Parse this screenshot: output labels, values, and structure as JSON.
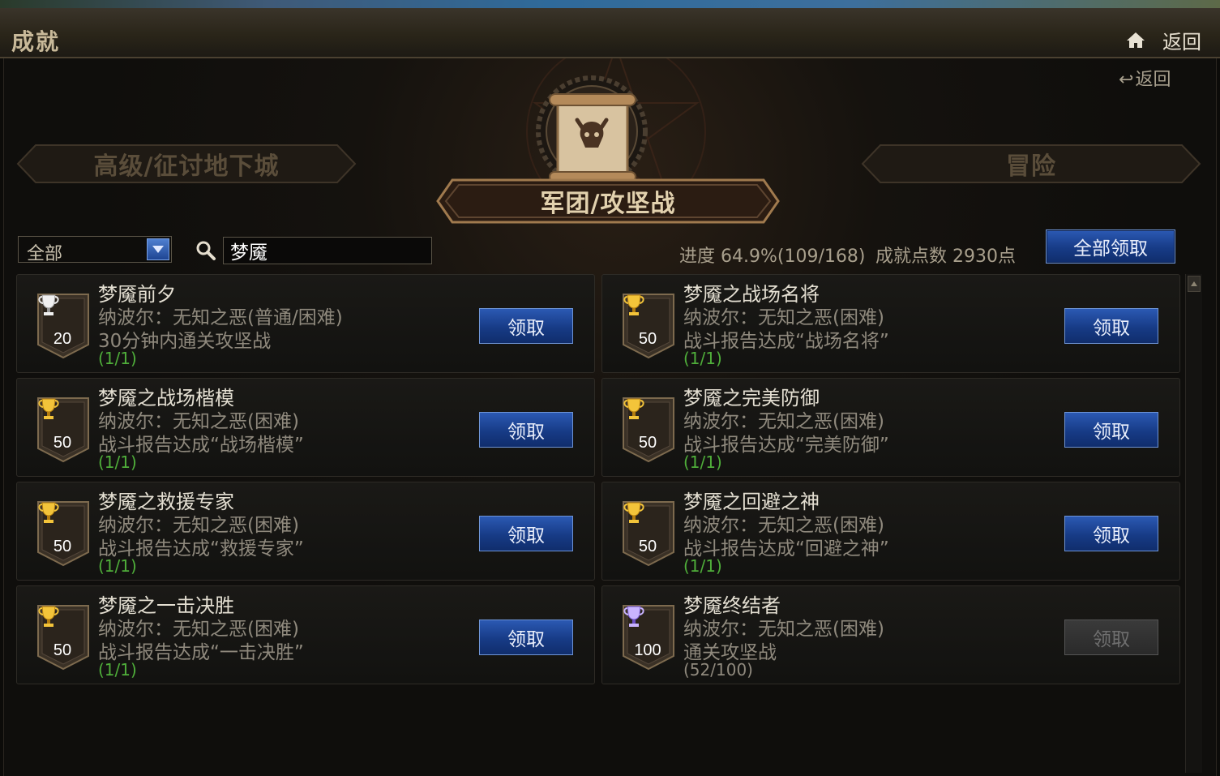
{
  "header": {
    "title": "成就",
    "back_label": "返回"
  },
  "sub_back_label": "返回",
  "tabs": {
    "left": "高级/征讨地下城",
    "center": "军团/攻坚战",
    "right": "冒险"
  },
  "filter": {
    "select_value": "全部",
    "search_value": "梦魇"
  },
  "summary": {
    "progress_label": "进度",
    "progress_value": "64.9%(109/168)",
    "points_label": "成就点数",
    "points_value": "2930点",
    "claim_all_label": "全部领取"
  },
  "colors": {
    "button_blue": "#173b86",
    "progress_green": "#4fae3a",
    "gold_trophy": "#d9a21b",
    "silver_trophy": "#d0d0d0",
    "purple_trophy": "#9b7fe0"
  },
  "achievements": [
    {
      "name": "梦魇前夕",
      "dungeon": "纳波尔：无知之恶(普通/困难)",
      "desc": "30分钟内通关攻坚战",
      "progress": "(1/1)",
      "points": "20",
      "trophy": "silver-trophy-icon",
      "claim_label": "领取",
      "claimable": true
    },
    {
      "name": "梦魇之战场名将",
      "dungeon": "纳波尔：无知之恶(困难)",
      "desc": "战斗报告达成“战场名将”",
      "progress": "(1/1)",
      "points": "50",
      "trophy": "gold-trophy-icon",
      "claim_label": "领取",
      "claimable": true
    },
    {
      "name": "梦魇之战场楷模",
      "dungeon": "纳波尔：无知之恶(困难)",
      "desc": "战斗报告达成“战场楷模”",
      "progress": "(1/1)",
      "points": "50",
      "trophy": "gold-trophy-icon",
      "claim_label": "领取",
      "claimable": true
    },
    {
      "name": "梦魇之完美防御",
      "dungeon": "纳波尔：无知之恶(困难)",
      "desc": "战斗报告达成“完美防御”",
      "progress": "(1/1)",
      "points": "50",
      "trophy": "gold-trophy-icon",
      "claim_label": "领取",
      "claimable": true
    },
    {
      "name": "梦魇之救援专家",
      "dungeon": "纳波尔：无知之恶(困难)",
      "desc": "战斗报告达成“救援专家”",
      "progress": "(1/1)",
      "points": "50",
      "trophy": "gold-trophy-icon",
      "claim_label": "领取",
      "claimable": true
    },
    {
      "name": "梦魇之回避之神",
      "dungeon": "纳波尔：无知之恶(困难)",
      "desc": "战斗报告达成“回避之神”",
      "progress": "(1/1)",
      "points": "50",
      "trophy": "gold-trophy-icon",
      "claim_label": "领取",
      "claimable": true
    },
    {
      "name": "梦魇之一击决胜",
      "dungeon": "纳波尔：无知之恶(困难)",
      "desc": "战斗报告达成“一击决胜”",
      "progress": "(1/1)",
      "points": "50",
      "trophy": "gold-trophy-icon",
      "claim_label": "领取",
      "claimable": true
    },
    {
      "name": "梦魇终结者",
      "dungeon": "纳波尔：无知之恶(困难)",
      "desc": "通关攻坚战",
      "progress": "(52/100)",
      "points": "100",
      "trophy": "purple-trophy-icon",
      "claim_label": "领取",
      "claimable": false
    }
  ]
}
